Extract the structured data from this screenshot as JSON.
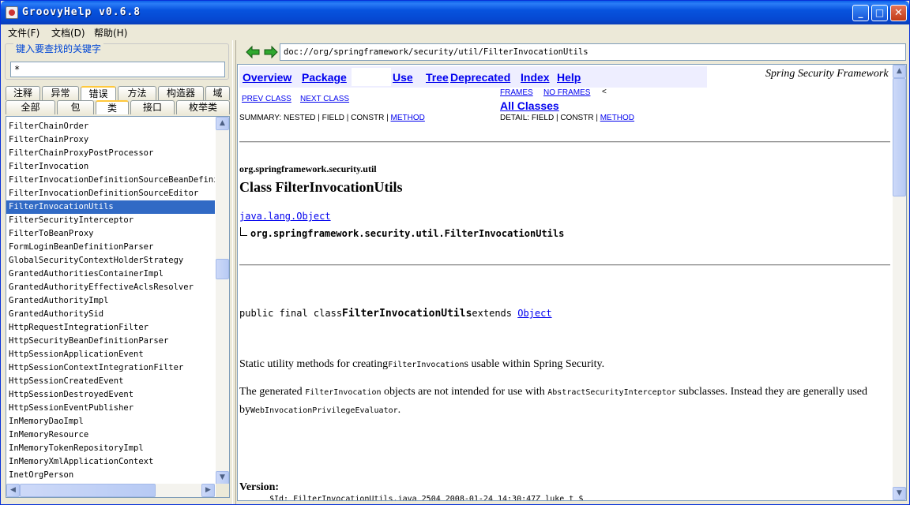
{
  "window": {
    "title": "GroovyHelp v0.6.8",
    "minimize": "_",
    "maximize": "□",
    "close": "✕"
  },
  "menu": {
    "file": "文件(F)",
    "doc": "文档(D)",
    "help": "帮助(H)"
  },
  "search": {
    "label": "键入要查找的关键字",
    "value": "*"
  },
  "tabs_row1": [
    "注释",
    "异常",
    "错误",
    "方法",
    "构造器",
    "域"
  ],
  "tabs_row2": [
    "全部",
    "包",
    "类",
    "接口",
    "枚举类"
  ],
  "class_list": [
    "FilterChainOrder",
    "FilterChainProxy",
    "FilterChainProxyPostProcessor",
    "FilterInvocation",
    "FilterInvocationDefinitionSourceBeanDefinit:",
    "FilterInvocationDefinitionSourceEditor",
    "FilterInvocationUtils",
    "FilterSecurityInterceptor",
    "FilterToBeanProxy",
    "FormLoginBeanDefinitionParser",
    "GlobalSecurityContextHolderStrategy",
    "GrantedAuthoritiesContainerImpl",
    "GrantedAuthorityEffectiveAclsResolver",
    "GrantedAuthorityImpl",
    "GrantedAuthoritySid",
    "HttpRequestIntegrationFilter",
    "HttpSecurityBeanDefinitionParser",
    "HttpSessionApplicationEvent",
    "HttpSessionContextIntegrationFilter",
    "HttpSessionCreatedEvent",
    "HttpSessionDestroyedEvent",
    "HttpSessionEventPublisher",
    "InMemoryDaoImpl",
    "InMemoryResource",
    "InMemoryTokenRepositoryImpl",
    "InMemoryXmlApplicationContext",
    "InetOrgPerson"
  ],
  "selected_class": "FilterInvocationUtils",
  "address": "doc://org/springframework/security/util/FilterInvocationUtils",
  "doc": {
    "nav": {
      "overview": "Overview",
      "package": "Package",
      "use": "Use",
      "tree": "Tree",
      "deprecated": "Deprecated",
      "index": "Index",
      "help": "Help"
    },
    "brand": "Spring Security Framework",
    "prev_class": "PREV CLASS",
    "next_class": "NEXT CLASS",
    "frames": "FRAMES",
    "no_frames": "NO FRAMES",
    "lt": "<",
    "all_classes": "All Classes",
    "summary_prefix": "SUMMARY: NESTED | FIELD | CONSTR | ",
    "summary_method": "METHOD",
    "detail_prefix": "DETAIL: FIELD | CONSTR | ",
    "detail_method": "METHOD",
    "package_name": "org.springframework.security.util",
    "class_title": "Class FilterInvocationUtils",
    "super_class": "java.lang.Object",
    "tree_class": "org.springframework.security.util.FilterInvocationUtils",
    "decl_prefix": "public final class",
    "decl_class": "FilterInvocationUtils",
    "decl_extends": "extends ",
    "decl_super": "Object",
    "para1_a": "Static utility methods for creating",
    "para1_code": "FilterInvocation",
    "para1_b": "s usable within Spring Security.",
    "para2_a": "The generated ",
    "para2_code1": "FilterInvocation",
    "para2_b": " objects are not intended for use with ",
    "para2_code2": "AbstractSecurityInterceptor",
    "para2_c": " subclasses. Instead they are generally used by",
    "para2_code3": "WebInvocationPrivilegeEvaluator",
    "para2_d": ".",
    "version_label": "Version:",
    "version_value": "$Id: FilterInvocationUtils.java 2504 2008-01-24 14:30:47Z luke_t $"
  }
}
